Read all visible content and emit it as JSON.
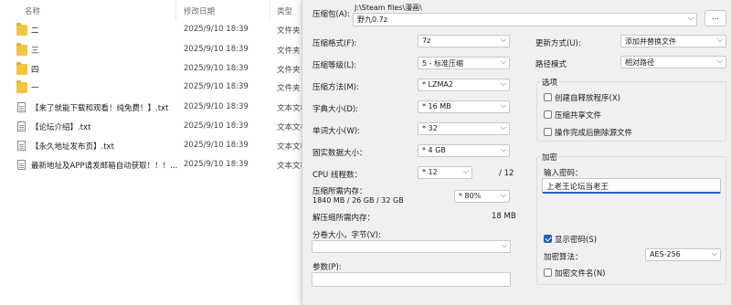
{
  "explorer": {
    "columns": {
      "name": "名称",
      "date": "修改日期",
      "type": "类型"
    },
    "rows": [
      {
        "icon": "folder-icon",
        "name": "二",
        "date": "2025/9/10 18:39",
        "type": "文件夹"
      },
      {
        "icon": "folder-icon",
        "name": "三",
        "date": "2025/9/10 18:39",
        "type": "文件夹"
      },
      {
        "icon": "folder-icon",
        "name": "四",
        "date": "2025/9/10 18:39",
        "type": "文件夹"
      },
      {
        "icon": "folder-icon",
        "name": "一",
        "date": "2025/9/10 18:39",
        "type": "文件夹"
      },
      {
        "icon": "text-file-icon",
        "name": "【来了就能下载和观看！纯免费！】.txt",
        "date": "2025/9/10 18:39",
        "type": "文本文档"
      },
      {
        "icon": "text-file-icon",
        "name": "【论坛介绍】.txt",
        "date": "2025/9/10 18:39",
        "type": "文本文档"
      },
      {
        "icon": "text-file-icon",
        "name": "【永久地址发布页】.txt",
        "date": "2025/9/10 18:39",
        "type": "文本文档"
      },
      {
        "icon": "text-file-icon",
        "name": "最新地址及APP请发邮箱自动获取！！！...",
        "date": "2025/9/10 18:39",
        "type": "文本文档"
      }
    ]
  },
  "dialog": {
    "archive_label": "压缩包(A):",
    "archive_path": "J:\\Steam files\\漫画\\",
    "archive_name": "野九0.7z",
    "browse_label": "...",
    "format_label": "压缩格式(F):",
    "format_value": "7z",
    "level_label": "压缩等级(L):",
    "level_value": "5 - 标准压缩",
    "method_label": "压缩方法(M):",
    "method_value": "* LZMA2",
    "dict_label": "字典大小(D):",
    "dict_value": "* 16 MB",
    "word_label": "单词大小(W):",
    "word_value": "* 32",
    "solid_label": "固实数据大小：",
    "solid_value": "* 4 GB",
    "threads_label": "CPU 线程数：",
    "threads_value": "* 12",
    "threads_max": "/ 12",
    "mem_comp_label": "压缩所需内存：",
    "mem_comp_detail": "1840 MB / 26 GB / 32 GB",
    "mem_comp_value": "* 80%",
    "mem_decomp_label": "解压缩所需内存：",
    "mem_decomp_value": "18 MB",
    "volume_label": "分卷大小，字节(V):",
    "volume_value": "",
    "params_label": "参数(P):",
    "params_value": "",
    "update_label": "更新方式(U):",
    "update_value": "添加并替换文件",
    "path_label": "路径模式",
    "path_value": "相对路径",
    "options": {
      "title": "选项",
      "sfx": "创建自释放程序(X)",
      "shared": "压缩共享文件",
      "delete": "操作完成后删除源文件"
    },
    "encryption": {
      "title": "加密",
      "password_label": "输入密码：",
      "password_value": "上老王论坛当老王",
      "show_password": "显示密码(S)",
      "show_password_checked": true,
      "method_label": "加密算法：",
      "method_value": "AES-256",
      "encrypt_names": "加密文件名(N)"
    }
  },
  "colors": {
    "accent": "#1f5fbf",
    "folder": "#f2c542",
    "dialog_bg": "#f0f0f0"
  }
}
